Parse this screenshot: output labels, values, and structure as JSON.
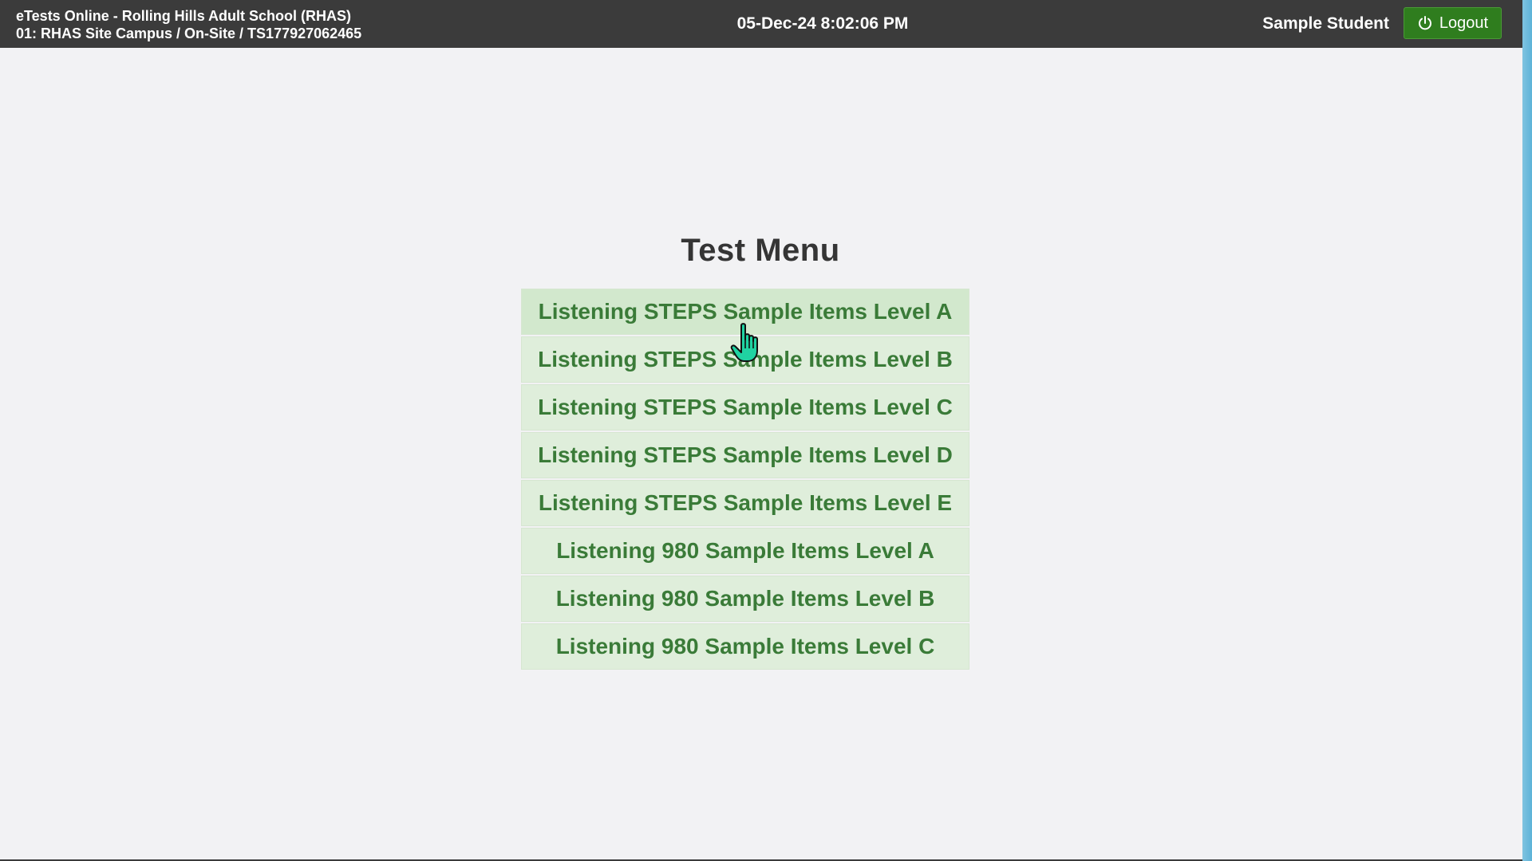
{
  "header": {
    "title_line1": "eTests Online - Rolling Hills Adult School (RHAS)",
    "title_line2": "01: RHAS Site Campus / On-Site / TS177927062465",
    "datetime": "05-Dec-24 8:02:06 PM",
    "user_name": "Sample Student",
    "logout_label": "Logout",
    "logout_icon": "power-icon"
  },
  "menu": {
    "title": "Test Menu",
    "items": [
      {
        "label": "Listening STEPS Sample Items Level A"
      },
      {
        "label": "Listening STEPS Sample Items Level B"
      },
      {
        "label": "Listening STEPS Sample Items Level C"
      },
      {
        "label": "Listening STEPS Sample Items Level D"
      },
      {
        "label": "Listening STEPS Sample Items Level E"
      },
      {
        "label": "Listening 980 Sample Items Level A"
      },
      {
        "label": "Listening 980 Sample Items Level B"
      },
      {
        "label": "Listening 980 Sample Items Level C"
      }
    ]
  },
  "colors": {
    "header_bg": "#3b3b3b",
    "logout_bg": "#2f7d1e",
    "menu_item_bg": "#dfeedb",
    "menu_item_text": "#3a7b38",
    "page_bg": "#f2f2f4"
  }
}
